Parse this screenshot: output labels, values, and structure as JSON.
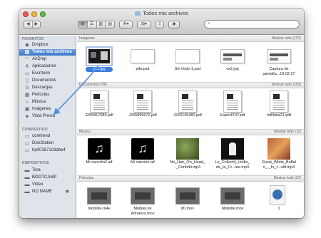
{
  "window": {
    "title": "Todos mis archivos"
  },
  "toolbar": {
    "back": "◀",
    "forward": "▶",
    "views": [
      "⊞",
      "☰",
      "▥",
      "▤"
    ],
    "action": "✲▾",
    "arrange": "⊞▾",
    "share": "⇪",
    "quicklook": "◉",
    "search_placeholder": ""
  },
  "sidebar": {
    "sections": [
      {
        "title": "FAVORITOS",
        "items": [
          {
            "label": "Dropbox",
            "icon": "dropbox-icon"
          },
          {
            "label": "Todos mis archivos",
            "icon": "all-files-icon",
            "selected": true
          },
          {
            "label": "AirDrop",
            "icon": "airdrop-icon"
          },
          {
            "label": "Aplicaciones",
            "icon": "applications-icon"
          },
          {
            "label": "Escritorio",
            "icon": "desktop-icon"
          },
          {
            "label": "Documentos",
            "icon": "documents-icon"
          },
          {
            "label": "Descargas",
            "icon": "downloads-icon"
          },
          {
            "label": "Películas",
            "icon": "movies-icon"
          },
          {
            "label": "Música",
            "icon": "music-icon"
          },
          {
            "label": "Imágenes",
            "icon": "pictures-icon"
          },
          {
            "label": "Vista Previa",
            "icon": "preview-icon"
          }
        ]
      },
      {
        "title": "COMPARTIDO",
        "items": [
          {
            "label": "comtrend",
            "icon": "network-computer-icon"
          },
          {
            "label": "DiskStation",
            "icon": "network-computer-icon"
          },
          {
            "label": "hp00187103dbe4",
            "icon": "network-computer-icon"
          }
        ]
      },
      {
        "title": "DISPOSITIVOS",
        "items": [
          {
            "label": "Tera",
            "icon": "drive-icon"
          },
          {
            "label": "BOOTCAMP",
            "icon": "drive-icon"
          },
          {
            "label": "Video",
            "icon": "drive-icon"
          },
          {
            "label": "NO NAME",
            "icon": "drive-icon",
            "eject": "⏏"
          }
        ]
      }
    ]
  },
  "content": {
    "sections": [
      {
        "title": "Imágenes",
        "more": "Mostrar todo (137)",
        "items": [
          {
            "name": "vs1.jpg",
            "kind": "screenshot",
            "selected": true
          },
          {
            "name": "pila.psd",
            "kind": "psd"
          },
          {
            "name": "Sin título-1.psd",
            "kind": "psd"
          },
          {
            "name": "vs2.jpg",
            "kind": "screen-light"
          },
          {
            "name": "Captura de\npantalla...19.02.27",
            "kind": "screen-light"
          }
        ]
      },
      {
        "title": "Documentos PDF",
        "more": "Mostrar todo (253)",
        "items": [
          {
            "name": "J255817089.pdf",
            "kind": "pdf"
          },
          {
            "name": "J255899672.pdf",
            "kind": "pdf"
          },
          {
            "name": "J263149482.pdf",
            "kind": "pdf"
          },
          {
            "name": "EspecD1P.pdf",
            "kind": "pdf"
          },
          {
            "name": "IntNotaD1.pdf",
            "kind": "pdf"
          }
        ]
      },
      {
        "title": "Música",
        "more": "Mostrar todo (11)",
        "items": [
          {
            "name": "Mi canción2.aif",
            "kind": "music"
          },
          {
            "name": "Mi canción.aif",
            "kind": "music"
          },
          {
            "name": "No_Hair_On_Head_\n-_Confetti.mp3",
            "kind": "album1"
          },
          {
            "name": "Le_Collectif_Unifie_\nde_la_Cr...iee.mp3",
            "kind": "album2"
          },
          {
            "name": "Great_White_Buffal\no_-_In_t...old.mp3",
            "kind": "album3"
          }
        ]
      },
      {
        "title": "Películas",
        "more": "Mostrar todo (37)",
        "items": [
          {
            "name": "Mobilite.m4v",
            "kind": "movie"
          },
          {
            "name": "MobileLite\nWireless.mov",
            "kind": "movie"
          },
          {
            "name": "MI.mov",
            "kind": "movie"
          },
          {
            "name": "Mobilite.mov",
            "kind": "movie"
          },
          {
            "name": "1",
            "kind": "quicktime"
          }
        ]
      }
    ]
  }
}
